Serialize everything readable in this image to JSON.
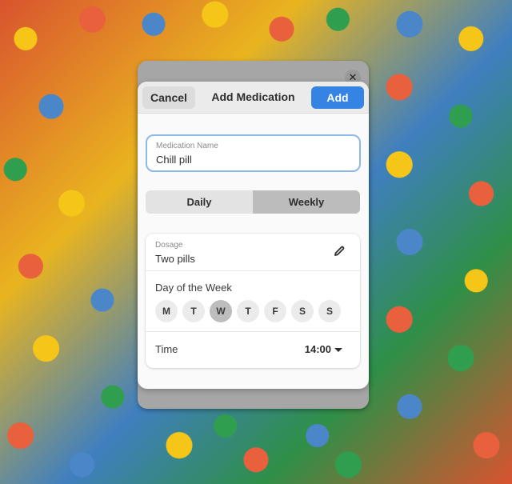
{
  "parent_window": {
    "close_icon": "close-icon"
  },
  "dialog": {
    "title": "Add Medication",
    "cancel_label": "Cancel",
    "add_label": "Add",
    "accent_color": "#3584e4"
  },
  "medication_name": {
    "label": "Medication Name",
    "value": "Chill pill"
  },
  "frequency": {
    "options": [
      "Daily",
      "Weekly"
    ],
    "selected": "Weekly"
  },
  "dosage": {
    "label": "Dosage",
    "value": "Two pills",
    "edit_icon": "pencil-icon"
  },
  "day_of_week": {
    "label": "Day of the Week",
    "days": [
      "M",
      "T",
      "W",
      "T",
      "F",
      "S",
      "S"
    ],
    "selected_index": 2
  },
  "time": {
    "label": "Time",
    "value": "14:00",
    "dropdown_icon": "dropdown-arrow-icon"
  }
}
